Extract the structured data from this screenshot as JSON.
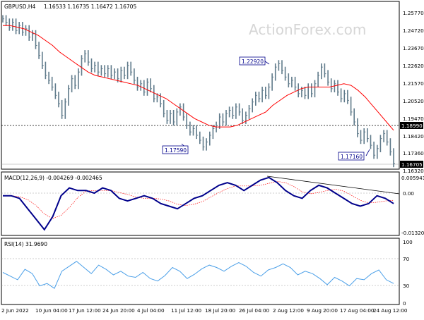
{
  "header": {
    "symbol": "GBPUSD,H4",
    "ohlc": "1.16533 1.16735 1.16472 1.16705"
  },
  "watermark": "ActionForex.com",
  "colors": {
    "price": "#607b8b",
    "ma": "#ff0000",
    "macd_main": "#00008b",
    "macd_signal": "#ff0000",
    "rsi": "#4a9fe8",
    "level_box": "#00008b",
    "current_bg": "#000000"
  },
  "price_panel": {
    "y_ticks": [
      "1.25770",
      "1.24720",
      "1.23670",
      "1.22620",
      "1.21570",
      "1.20520",
      "1.19470",
      "1.18420",
      "1.17360",
      "1.16320"
    ],
    "current_price": "1.16705",
    "horizontal_level": "1.18990",
    "annotations": [
      {
        "label": "1.22920"
      },
      {
        "label": "1.17590"
      },
      {
        "label": "1.17160"
      }
    ]
  },
  "macd_panel": {
    "label": "MACD(12,26,9) -0.004269 -0.002465",
    "y_ticks": [
      "0.005941",
      "0.00",
      "-0.013207"
    ]
  },
  "rsi_panel": {
    "label": "RSI(14) 31.9690",
    "y_ticks": [
      "100",
      "70",
      "30",
      "0"
    ]
  },
  "x_axis": {
    "labels": [
      "2 Jun 2022",
      "10 Jun 04:00",
      "17 Jun 12:00",
      "24 Jun 20:00",
      "4 Jul 04:00",
      "11 Jul 12:00",
      "18 Jul 20:00",
      "26 Jul 04:00",
      "2 Aug 12:00",
      "9 Aug 20:00",
      "17 Aug 04:00",
      "24 Aug 12:00"
    ]
  },
  "chart_data": {
    "type": "line",
    "title": "GBPUSD,H4",
    "price_close": [
      1.254,
      1.252,
      1.249,
      1.252,
      1.247,
      1.25,
      1.246,
      1.248,
      1.243,
      1.245,
      1.238,
      1.232,
      1.226,
      1.22,
      1.217,
      1.213,
      1.208,
      1.203,
      1.196,
      1.204,
      1.212,
      1.218,
      1.214,
      1.222,
      1.23,
      1.233,
      1.228,
      1.224,
      1.226,
      1.222,
      1.224,
      1.221,
      1.224,
      1.22,
      1.222,
      1.218,
      1.223,
      1.22,
      1.226,
      1.222,
      1.217,
      1.213,
      1.215,
      1.21,
      1.216,
      1.212,
      1.206,
      1.207,
      1.203,
      1.197,
      1.193,
      1.197,
      1.192,
      1.198,
      1.201,
      1.195,
      1.19,
      1.186,
      1.188,
      1.184,
      1.181,
      1.177,
      1.18,
      1.184,
      1.188,
      1.19,
      1.195,
      1.192,
      1.197,
      1.199,
      1.196,
      1.201,
      1.198,
      1.193,
      1.196,
      1.2,
      1.204,
      1.208,
      1.206,
      1.211,
      1.208,
      1.213,
      1.219,
      1.225,
      1.227,
      1.223,
      1.219,
      1.215,
      1.217,
      1.213,
      1.209,
      1.211,
      1.208,
      1.213,
      1.209,
      1.215,
      1.22,
      1.225,
      1.221,
      1.216,
      1.212,
      1.215,
      1.21,
      1.206,
      1.209,
      1.205,
      1.198,
      1.192,
      1.185,
      1.181,
      1.186,
      1.182,
      1.178,
      1.172,
      1.176,
      1.182,
      1.185,
      1.18,
      1.174,
      1.167
    ],
    "ma_line": [
      1.25,
      1.25,
      1.249,
      1.248,
      1.246,
      1.244,
      1.241,
      1.238,
      1.234,
      1.231,
      1.228,
      1.225,
      1.222,
      1.22,
      1.219,
      1.218,
      1.217,
      1.216,
      1.215,
      1.214,
      1.212,
      1.21,
      1.208,
      1.206,
      1.203,
      1.2,
      1.197,
      1.194,
      1.192,
      1.19,
      1.189,
      1.189,
      1.189,
      1.19,
      1.192,
      1.194,
      1.196,
      1.198,
      1.202,
      1.205,
      1.208,
      1.21,
      1.212,
      1.213,
      1.213,
      1.213,
      1.213,
      1.214,
      1.215,
      1.214,
      1.211,
      1.207,
      1.202,
      1.197,
      1.192,
      1.187
    ],
    "macd_main": [
      -0.001,
      -0.001,
      -0.002,
      -0.006,
      -0.01,
      -0.014,
      -0.009,
      -0.001,
      0.002,
      0.001,
      0.001,
      0.0,
      0.002,
      0.001,
      -0.002,
      -0.003,
      -0.002,
      -0.001,
      -0.002,
      -0.004,
      -0.005,
      -0.006,
      -0.004,
      -0.002,
      -0.001,
      0.001,
      0.003,
      0.004,
      0.003,
      0.001,
      0.003,
      0.005,
      0.006,
      0.004,
      0.001,
      -0.001,
      -0.002,
      0.001,
      0.003,
      0.002,
      0.0,
      -0.002,
      -0.004,
      -0.005,
      -0.004,
      -0.001,
      -0.002,
      -0.004
    ],
    "rsi": [
      50,
      44,
      38,
      55,
      48,
      28,
      32,
      24,
      52,
      60,
      68,
      58,
      48,
      62,
      55,
      46,
      52,
      44,
      42,
      50,
      40,
      36,
      45,
      58,
      52,
      40,
      47,
      56,
      62,
      58,
      52,
      60,
      66,
      60,
      50,
      44,
      54,
      58,
      64,
      58,
      46,
      52,
      48,
      40,
      30,
      42,
      36,
      28,
      40,
      38,
      48,
      54,
      38,
      32
    ]
  }
}
